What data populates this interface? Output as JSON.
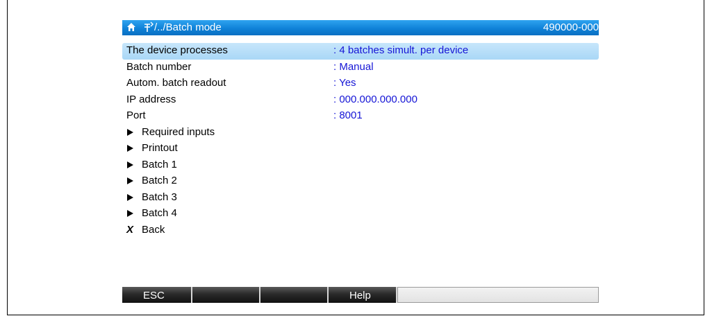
{
  "header": {
    "path": "/../Batch mode",
    "device_id": "490000-000",
    "home_icon": "home-icon",
    "menu_icon": "menu-fork-icon",
    "bar_color": "#1486dc"
  },
  "menu": {
    "settings": [
      {
        "label": "The device processes",
        "value": ": 4 batches simult. per device",
        "selected": true
      },
      {
        "label": "Batch number",
        "value": ": Manual"
      },
      {
        "label": "Autom. batch readout",
        "value": ": Yes"
      },
      {
        "label": "IP address",
        "value": ": 000.000.000.000"
      },
      {
        "label": "Port",
        "value": ": 8001"
      }
    ],
    "submenus": [
      {
        "label": "Required inputs"
      },
      {
        "label": "Printout"
      },
      {
        "label": "Batch 1"
      },
      {
        "label": "Batch 2"
      },
      {
        "label": "Batch 3"
      },
      {
        "label": "Batch 4"
      }
    ],
    "back": {
      "icon": "X",
      "label": "Back"
    },
    "value_color": "#1515d6",
    "selected_color": "#b4dcf8"
  },
  "softkeys": {
    "k1": "ESC",
    "k2": "",
    "k3": "",
    "k4": "Help",
    "k5": ""
  }
}
